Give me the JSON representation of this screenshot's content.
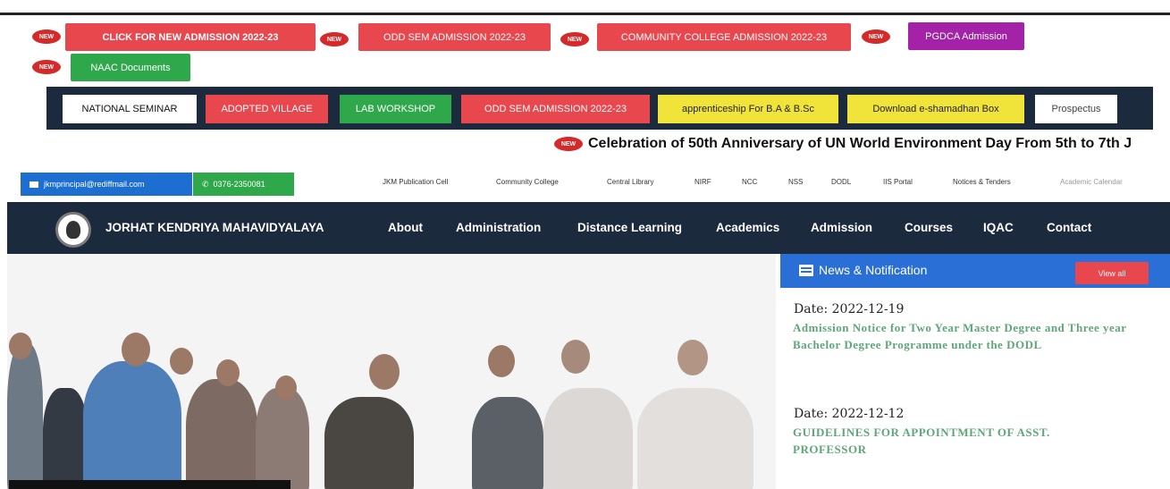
{
  "admissions": {
    "new_label": "NEW",
    "buttons": [
      "CLICK FOR NEW ADMISSION 2022-23",
      "ODD SEM ADMISSION 2022-23",
      "COMMUNITY COLLEGE ADMISSION 2022-23",
      "PGDCA Admission",
      "NAAC Documents"
    ]
  },
  "sem_bar": {
    "buttons": [
      "NATIONAL SEMINAR",
      "ADOPTED VILLAGE",
      "LAB WORKSHOP",
      "ODD SEM ADMISSION 2022-23",
      "apprenticeship For B.A & B.Sc",
      "Download e-shamadhan Box",
      "Prospectus"
    ]
  },
  "announcement": {
    "new_label": "NEW",
    "text": "Celebration of 50th Anniversary of UN World Environment Day From 5th to 7th J"
  },
  "contact": {
    "email": "jkmprincipal@rediffmail.com",
    "phone": "0376-2350081"
  },
  "top_links": [
    "JKM Publication Cell",
    "Community College",
    "Central Library",
    "NIRF",
    "NCC",
    "NSS",
    "DODL",
    "IIS Portal",
    "Notices & Tenders",
    "Academic Calendar"
  ],
  "navbar": {
    "brand": "JORHAT KENDRIYA MAHAVIDYALAYA",
    "items": [
      "About",
      "Administration",
      "Distance Learning",
      "Academics",
      "Admission",
      "Courses",
      "IQAC",
      "Contact"
    ]
  },
  "news": {
    "title": "News & Notification",
    "view_all": "View all",
    "items": [
      {
        "date": "Date: 2022-12-19",
        "text": "Admission Notice for Two Year Master Degree and Three year Bachelor Degree Programme under the DODL"
      },
      {
        "date": "Date: 2022-12-12",
        "text": "GUIDELINES FOR APPOINTMENT OF ASST. PROFESSOR"
      }
    ]
  },
  "colors": {
    "navy": "#1c2a3d",
    "red_button": "#e8474e",
    "green_button": "#2ea84a",
    "purple_button": "#a322a8",
    "yellow_button": "#f0e33a",
    "news_blue": "#2a6fd6"
  }
}
